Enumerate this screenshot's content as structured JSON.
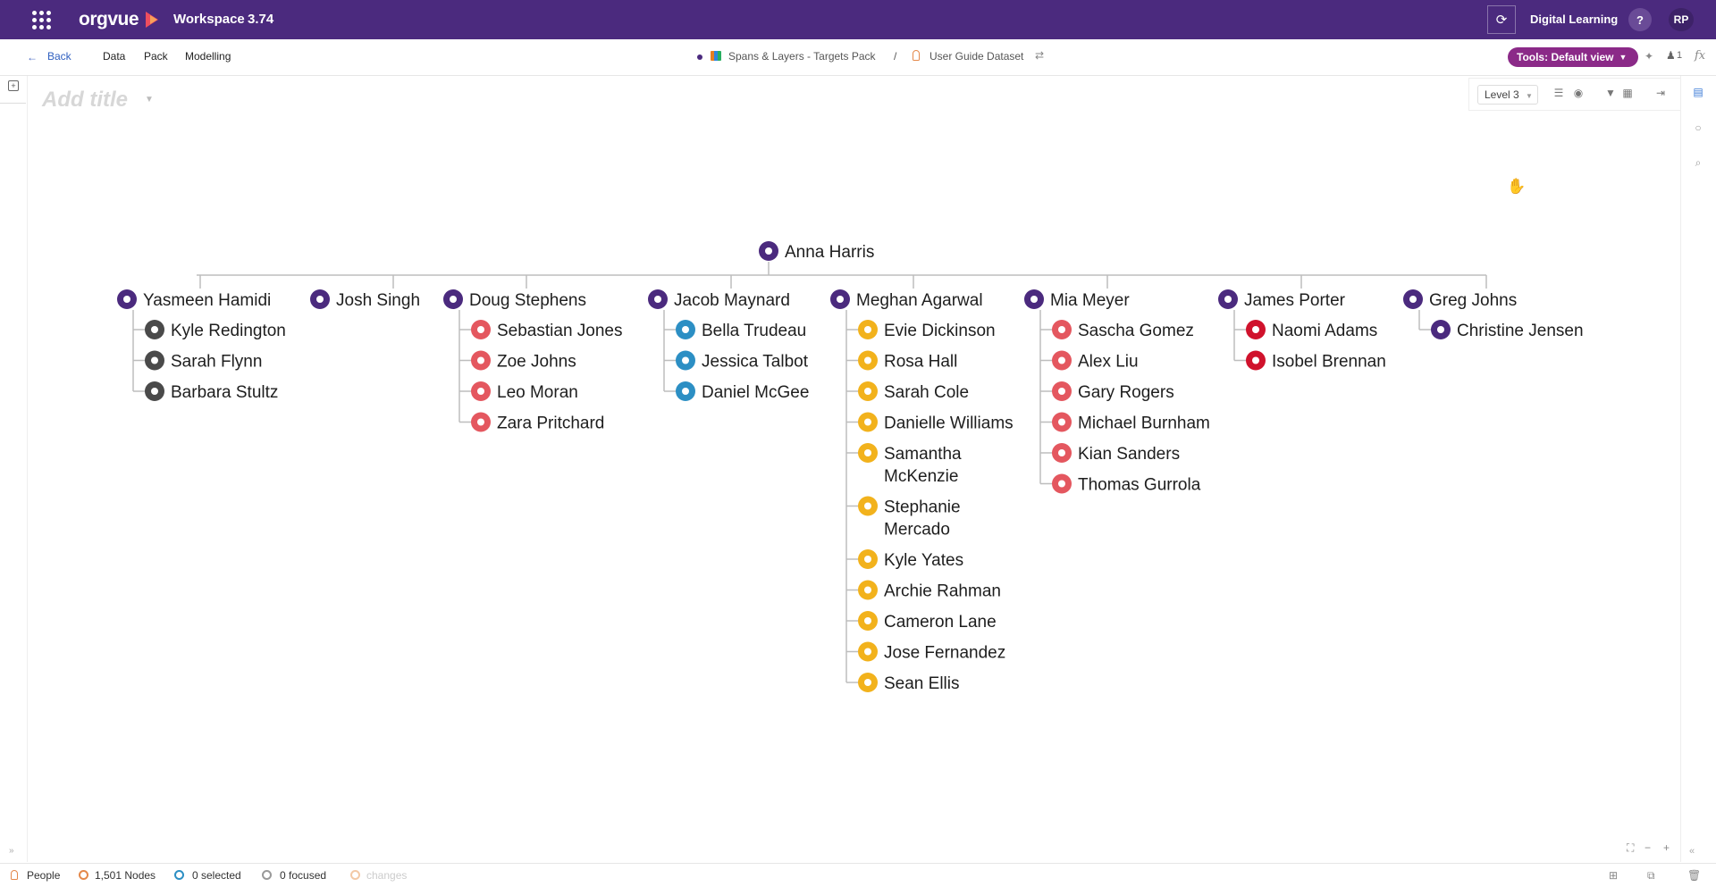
{
  "topbar": {
    "brand": "orgvue",
    "workspace": "Workspace",
    "version": "3.74",
    "user_org": "Digital Learning",
    "help": "?",
    "avatar_initials": "RP"
  },
  "subbar": {
    "back_label": "Back",
    "nav": [
      "Data",
      "Pack",
      "Modelling"
    ],
    "pack_name": "Spans & Layers - Targets Pack",
    "separator": "/",
    "dataset_name": "User Guide Dataset",
    "tools_label": "Tools: Default view",
    "users_count": "1"
  },
  "canvas": {
    "title_placeholder": "Add title",
    "level_label": "Level 3"
  },
  "org": {
    "root": "Anna Harris",
    "colors": {
      "purple": "#4b2a7e",
      "grey": "#4a4a4a",
      "coral": "#e4575f",
      "blue": "#2c8fc4",
      "amber": "#f2b21c",
      "red": "#d0122c"
    },
    "managers": [
      {
        "name": "Yasmeen Hamidi",
        "color": "purple",
        "reports": [
          {
            "lines": [
              "Kyle Redington"
            ],
            "color": "grey"
          },
          {
            "lines": [
              "Sarah Flynn"
            ],
            "color": "grey"
          },
          {
            "lines": [
              "Barbara Stultz"
            ],
            "color": "grey"
          }
        ]
      },
      {
        "name": "Josh Singh",
        "color": "purple",
        "reports": []
      },
      {
        "name": "Doug Stephens",
        "color": "purple",
        "reports": [
          {
            "lines": [
              "Sebastian Jones"
            ],
            "color": "coral"
          },
          {
            "lines": [
              "Zoe Johns"
            ],
            "color": "coral"
          },
          {
            "lines": [
              "Leo Moran"
            ],
            "color": "coral"
          },
          {
            "lines": [
              "Zara Pritchard"
            ],
            "color": "coral"
          }
        ]
      },
      {
        "name": "Jacob Maynard",
        "color": "purple",
        "reports": [
          {
            "lines": [
              "Bella Trudeau"
            ],
            "color": "blue"
          },
          {
            "lines": [
              "Jessica Talbot"
            ],
            "color": "blue"
          },
          {
            "lines": [
              "Daniel McGee"
            ],
            "color": "blue"
          }
        ]
      },
      {
        "name": "Meghan Agarwal",
        "color": "purple",
        "reports": [
          {
            "lines": [
              "Evie Dickinson"
            ],
            "color": "amber"
          },
          {
            "lines": [
              "Rosa Hall"
            ],
            "color": "amber"
          },
          {
            "lines": [
              "Sarah Cole"
            ],
            "color": "amber"
          },
          {
            "lines": [
              "Danielle Williams"
            ],
            "color": "amber"
          },
          {
            "lines": [
              "Samantha",
              "McKenzie"
            ],
            "color": "amber"
          },
          {
            "lines": [
              "Stephanie",
              "Mercado"
            ],
            "color": "amber"
          },
          {
            "lines": [
              "Kyle Yates"
            ],
            "color": "amber"
          },
          {
            "lines": [
              "Archie Rahman"
            ],
            "color": "amber"
          },
          {
            "lines": [
              "Cameron Lane"
            ],
            "color": "amber"
          },
          {
            "lines": [
              "Jose Fernandez"
            ],
            "color": "amber"
          },
          {
            "lines": [
              "Sean Ellis"
            ],
            "color": "amber"
          }
        ]
      },
      {
        "name": "Mia Meyer",
        "color": "purple",
        "reports": [
          {
            "lines": [
              "Sascha Gomez"
            ],
            "color": "coral"
          },
          {
            "lines": [
              "Alex Liu"
            ],
            "color": "coral"
          },
          {
            "lines": [
              "Gary Rogers"
            ],
            "color": "coral"
          },
          {
            "lines": [
              "Michael Burnham"
            ],
            "color": "coral"
          },
          {
            "lines": [
              "Kian Sanders"
            ],
            "color": "coral"
          },
          {
            "lines": [
              "Thomas Gurrola"
            ],
            "color": "coral"
          }
        ]
      },
      {
        "name": "James Porter",
        "color": "purple",
        "reports": [
          {
            "lines": [
              "Naomi Adams"
            ],
            "color": "red"
          },
          {
            "lines": [
              "Isobel Brennan"
            ],
            "color": "red"
          }
        ]
      },
      {
        "name": "Greg Johns",
        "color": "purple",
        "reports": [
          {
            "lines": [
              "Christine Jensen"
            ],
            "color": "purple"
          }
        ]
      }
    ]
  },
  "status": {
    "dimension": "People",
    "nodes": "1,501 Nodes",
    "selected": "0 selected",
    "focused": "0 focused",
    "changes": "changes"
  }
}
